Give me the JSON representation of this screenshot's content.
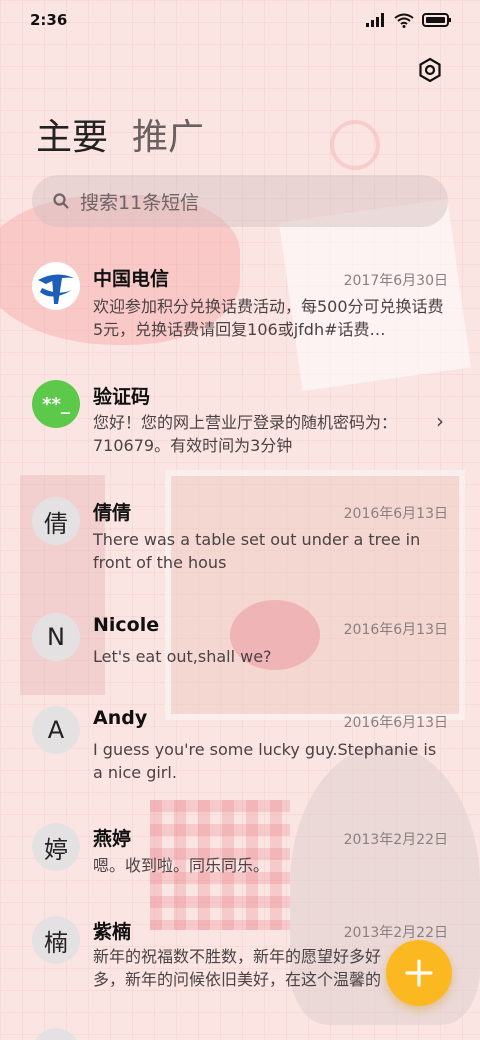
{
  "status_bar": {
    "time": "2:36"
  },
  "tabs": [
    {
      "label": "主要"
    },
    {
      "label": "推广"
    }
  ],
  "search": {
    "placeholder": "搜索11条短信"
  },
  "messages": [
    {
      "name": "中国电信",
      "date": "2017年6月30日",
      "preview": "欢迎参加积分兑换话费活动，每500分可兑换话费5元，兑换话费请回复106或jfdh#话费…",
      "avatar": "telecom-logo"
    },
    {
      "name": "验证码",
      "date": "",
      "preview": "您好！您的网上营业厅登录的随机密码为：710679。有效时间为3分钟",
      "avatar_text": "**_"
    },
    {
      "name": "倩倩",
      "date": "2016年6月13日",
      "preview": "There was a table set out under a tree in front of the hous",
      "avatar_text": "倩"
    },
    {
      "name": "Nicole",
      "date": "2016年6月13日",
      "preview": "Let's eat out,shall we?",
      "avatar_text": "N"
    },
    {
      "name": "Andy",
      "date": "2016年6月13日",
      "preview": "I guess you're some lucky guy.Stephanie is a nice girl.",
      "avatar_text": "A"
    },
    {
      "name": "燕婷",
      "date": "2013年2月22日",
      "preview": "嗯。收到啦。同乐同乐。",
      "avatar_text": "婷"
    },
    {
      "name": "紫楠",
      "date": "2013年2月22日",
      "preview": "新年的祝福数不胜数，新年的愿望好多好多，新年的问候依旧美好，在这个温馨的时刻",
      "avatar_text": "楠"
    }
  ],
  "colors": {
    "fab": "#fbb820",
    "verification_avatar": "#5cc94a",
    "telecom_blue": "#1d5fb8"
  }
}
